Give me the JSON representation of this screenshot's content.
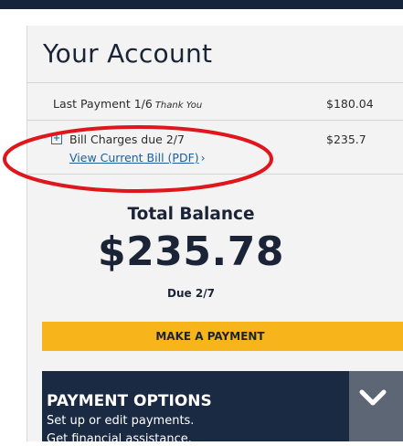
{
  "account": {
    "title": "Your Account",
    "last_payment": {
      "label": "Last Payment 1/6",
      "note": "Thank You",
      "amount": "$180.04"
    },
    "bill_charges": {
      "label": "Bill Charges due 2/7",
      "amount": "$235.7",
      "link": "View Current Bill (PDF)",
      "link_arrow": "›"
    },
    "total_balance": {
      "label": "Total Balance",
      "value": "$235.78",
      "due": "Due 2/7"
    },
    "make_payment_label": "MAKE A PAYMENT"
  },
  "payment_options": {
    "title": "PAYMENT OPTIONS",
    "line1": "Set up or edit payments.",
    "line2": "Get financial assistance."
  },
  "colors": {
    "navy": "#1a2a43",
    "accent_yellow": "#f7b51b",
    "link_blue": "#1b5f9b",
    "annotation_red": "#e0161d"
  },
  "icons": {
    "expand": "plus-box-icon",
    "toggle": "chevron-down-icon"
  }
}
